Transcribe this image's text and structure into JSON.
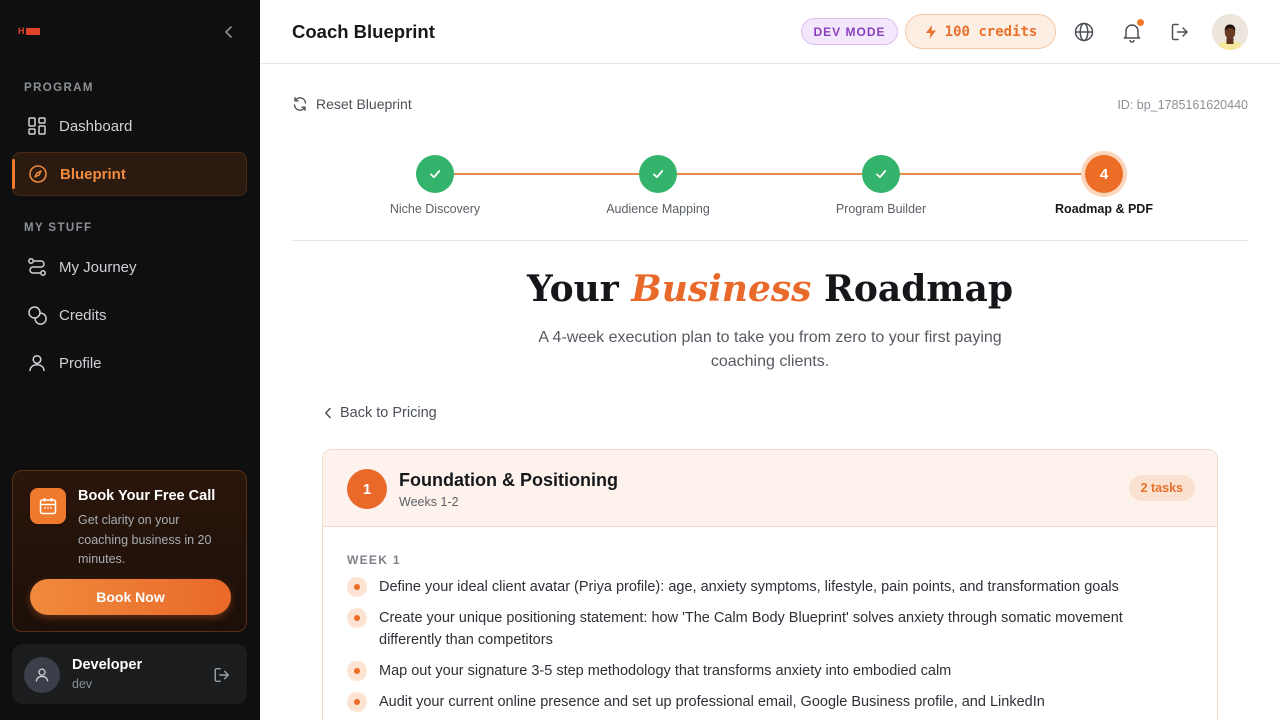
{
  "sidebar": {
    "logo_text": "H",
    "sections": {
      "program": "PROGRAM",
      "my_stuff": "MY STUFF"
    },
    "items": [
      {
        "label": "Dashboard",
        "icon": "grid-icon"
      },
      {
        "label": "Blueprint",
        "icon": "compass-icon",
        "active": true
      },
      {
        "label": "My Journey",
        "icon": "route-icon"
      },
      {
        "label": "Credits",
        "icon": "coins-icon"
      },
      {
        "label": "Profile",
        "icon": "user-icon"
      }
    ],
    "promo": {
      "title": "Book Your Free Call",
      "description": "Get clarity on your coaching business in 20 minutes.",
      "button": "Book Now"
    },
    "user": {
      "name": "Developer",
      "handle": "dev"
    }
  },
  "header": {
    "title": "Coach Blueprint",
    "dev_badge": "DEV MODE",
    "credits": "100 credits"
  },
  "toolbar": {
    "reset_label": "Reset Blueprint",
    "blueprint_id": "ID: bp_1785161620440"
  },
  "stepper": {
    "steps": [
      {
        "label": "Niche Discovery",
        "status": "complete"
      },
      {
        "label": "Audience Mapping",
        "status": "complete"
      },
      {
        "label": "Program Builder",
        "status": "complete"
      },
      {
        "label": "Roadmap & PDF",
        "status": "current",
        "number": "4"
      }
    ]
  },
  "hero": {
    "title_pre": "Your ",
    "title_em": "Business",
    "title_post": " Roadmap",
    "subtitle": "A 4-week execution plan to take you from zero to your first paying coaching clients."
  },
  "back_link": "Back to Pricing",
  "phase": {
    "number": "1",
    "title": "Foundation & Positioning",
    "weeks": "Weeks 1-2",
    "tasks_count": "2 tasks",
    "week_label": "WEEK 1",
    "tasks": [
      "Define your ideal client avatar (Priya profile): age, anxiety symptoms, lifestyle, pain points, and transformation goals",
      "Create your unique positioning statement: how 'The Calm Body Blueprint' solves anxiety through somatic movement differently than competitors",
      "Map out your signature 3-5 step methodology that transforms anxiety into embodied calm",
      "Audit your current online presence and set up professional email, Google Business profile, and LinkedIn"
    ]
  },
  "colors": {
    "accent": "#e9692a",
    "success": "#33b36b",
    "sidebar_bg": "#0f0f10"
  }
}
